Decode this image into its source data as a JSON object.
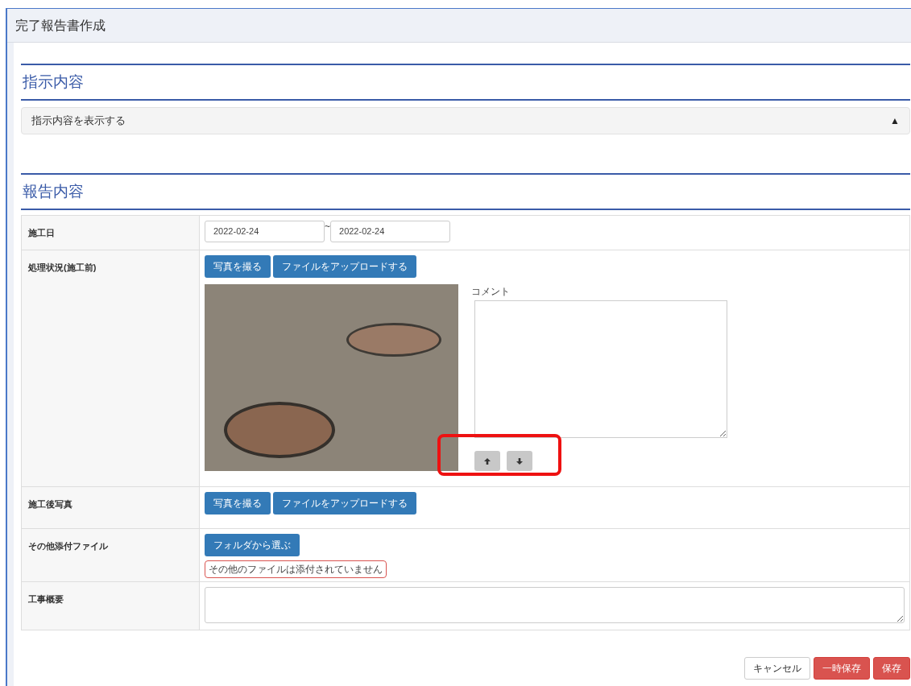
{
  "window": {
    "title": "完了報告書作成"
  },
  "instructions": {
    "heading": "指示内容",
    "toggle": {
      "label": "指示内容を表示する",
      "icon": "▲"
    }
  },
  "report": {
    "heading": "報告内容",
    "rows": [
      {
        "kind": "dates",
        "label": "施工日",
        "from": "2022-02-24",
        "separator": "~",
        "to": "2022-02-24"
      },
      {
        "kind": "photos",
        "label": "処理状況(施工前)",
        "buttons": [
          "写真を撮る",
          "ファイルをアップロードする"
        ],
        "photo": {
          "comment_label": "コメント"
        }
      },
      {
        "kind": "photos",
        "label": "施工後写真",
        "buttons": [
          "写真を撮る",
          "ファイルをアップロードする"
        ]
      },
      {
        "kind": "files",
        "label": "その他添付ファイル",
        "buttons": [
          "フォルダから選ぶ"
        ],
        "notice": "その他のファイルは添付されていません"
      },
      {
        "kind": "textarea",
        "label": "工事概要"
      }
    ]
  },
  "footer": {
    "buttons": [
      {
        "label": "キャンセル",
        "kind": "default"
      },
      {
        "label": "一時保存",
        "kind": "danger"
      },
      {
        "label": "保存",
        "kind": "danger"
      }
    ]
  }
}
